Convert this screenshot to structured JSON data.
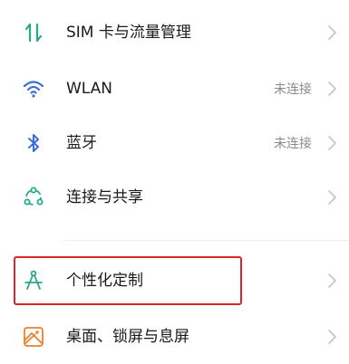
{
  "settings": {
    "items": [
      {
        "label": "SIM 卡与流量管理",
        "value": "",
        "icon": "sim-data-arrows-icon"
      },
      {
        "label": "WLAN",
        "value": "未连接",
        "icon": "wifi-icon"
      },
      {
        "label": "蓝牙",
        "value": "未连接",
        "icon": "bluetooth-icon"
      },
      {
        "label": "连接与共享",
        "value": "",
        "icon": "connection-sharing-icon"
      },
      {
        "label": "个性化定制",
        "value": "",
        "icon": "compass-personalize-icon"
      },
      {
        "label": "桌面、锁屏与息屏",
        "value": "",
        "icon": "wallpaper-icon"
      }
    ],
    "highlighted_item": "个性化定制"
  },
  "colors": {
    "icon_teal": "#2aa88a",
    "icon_blue": "#3a6fd8",
    "icon_orange": "#e8832a",
    "highlight_red": "#d8262a",
    "value_gray": "#8a8a8a",
    "chevron_gray": "#c4c4c4"
  }
}
